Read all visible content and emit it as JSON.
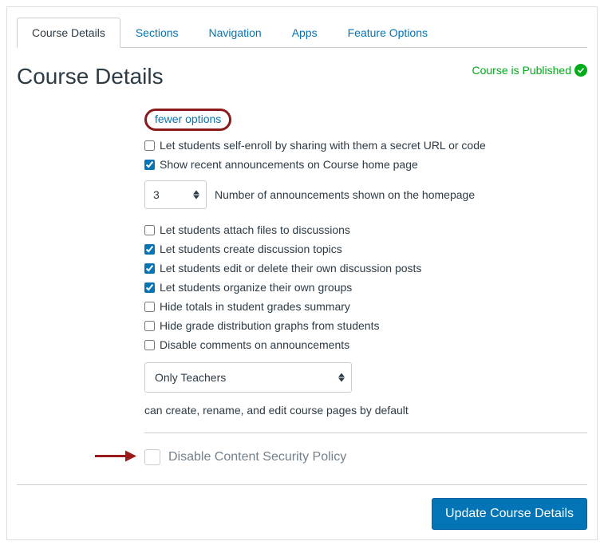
{
  "tabs": {
    "items": [
      {
        "label": "Course Details",
        "active": true
      },
      {
        "label": "Sections",
        "active": false
      },
      {
        "label": "Navigation",
        "active": false
      },
      {
        "label": "Apps",
        "active": false
      },
      {
        "label": "Feature Options",
        "active": false
      }
    ]
  },
  "header": {
    "title": "Course Details",
    "publish_status": "Course is Published"
  },
  "options": {
    "fewer_options_label": "fewer options",
    "items": [
      {
        "label": "Let students self-enroll by sharing with them a secret URL or code",
        "checked": false
      },
      {
        "label": "Show recent announcements on Course home page",
        "checked": true
      }
    ],
    "announcement_count": {
      "value": "3",
      "label": "Number of announcements shown on the homepage"
    },
    "items2": [
      {
        "label": "Let students attach files to discussions",
        "checked": false
      },
      {
        "label": "Let students create discussion topics",
        "checked": true
      },
      {
        "label": "Let students edit or delete their own discussion posts",
        "checked": true
      },
      {
        "label": "Let students organize their own groups",
        "checked": true
      },
      {
        "label": "Hide totals in student grades summary",
        "checked": false
      },
      {
        "label": "Hide grade distribution graphs from students",
        "checked": false
      },
      {
        "label": "Disable comments on announcements",
        "checked": false
      }
    ],
    "pages_role_select": {
      "value": "Only Teachers"
    },
    "pages_role_caption": "can create, rename, and edit course pages by default"
  },
  "csp": {
    "label": "Disable Content Security Policy",
    "checked": false
  },
  "footer": {
    "update_button": "Update Course Details"
  }
}
